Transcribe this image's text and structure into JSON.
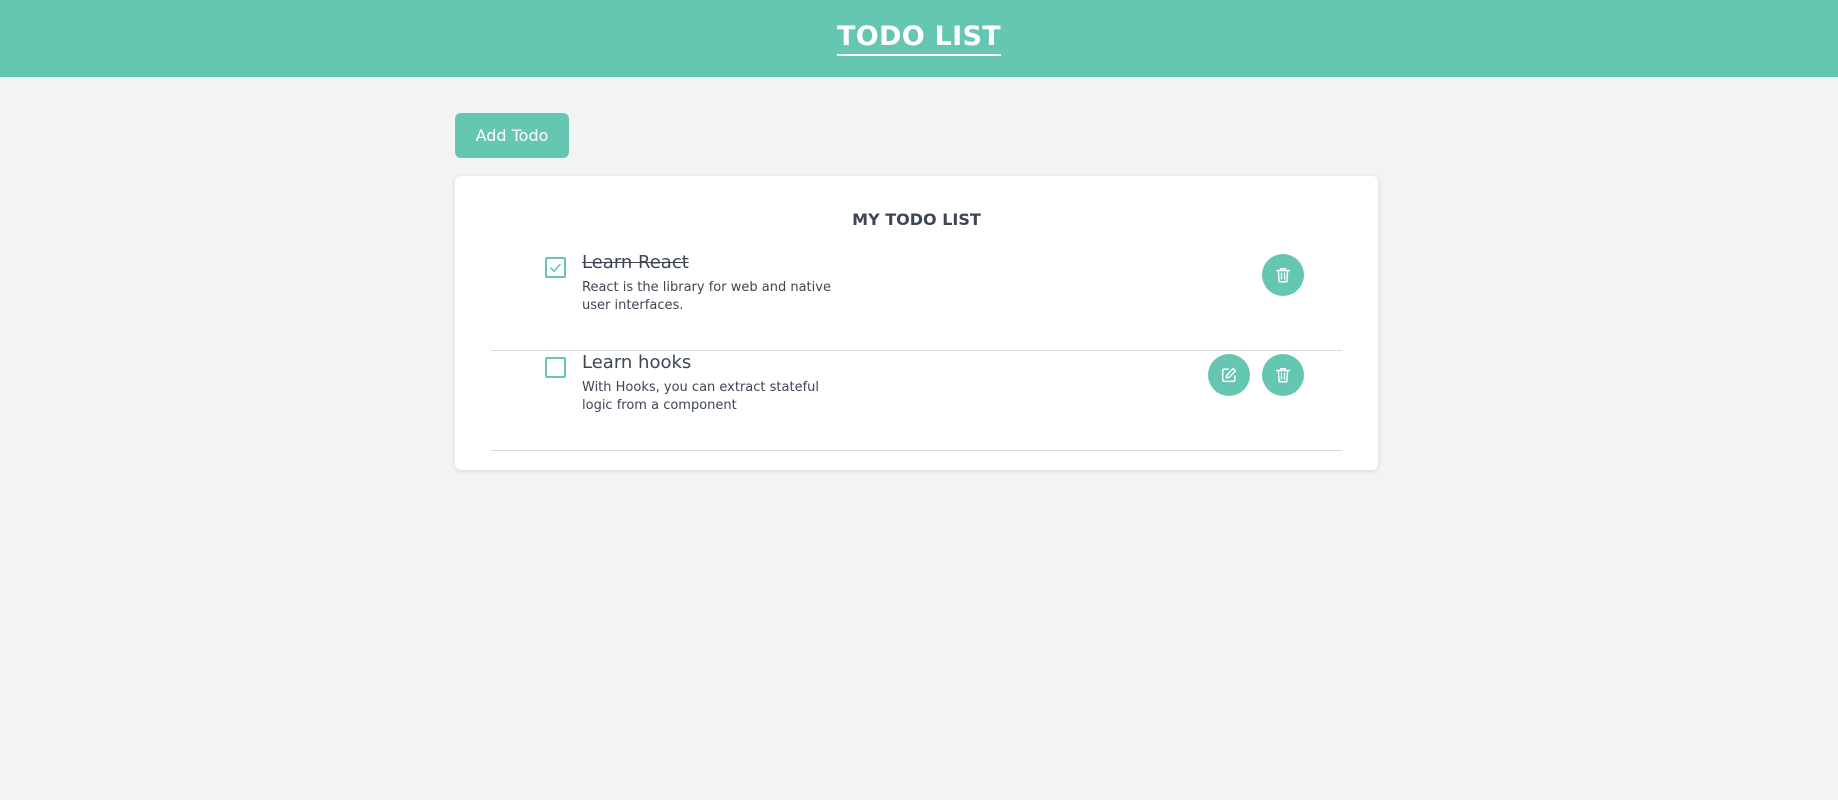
{
  "header": {
    "title": "TODO LIST"
  },
  "toolbar": {
    "add_label": "Add Todo"
  },
  "card": {
    "title": "MY TODO LIST"
  },
  "todos": [
    {
      "title": "Learn React",
      "description": "React is the library for web and native user interfaces.",
      "completed": true,
      "actions": [
        "delete"
      ]
    },
    {
      "title": "Learn hooks",
      "description": "With Hooks, you can extract stateful logic from a component",
      "completed": false,
      "actions": [
        "edit",
        "delete"
      ]
    }
  ],
  "icons": {
    "checkbox_checked": "check-icon",
    "edit": "edit-icon",
    "delete": "trash-icon"
  },
  "colors": {
    "accent": "#65c6b1",
    "background": "#f2f4f3",
    "text": "#3d4653"
  }
}
